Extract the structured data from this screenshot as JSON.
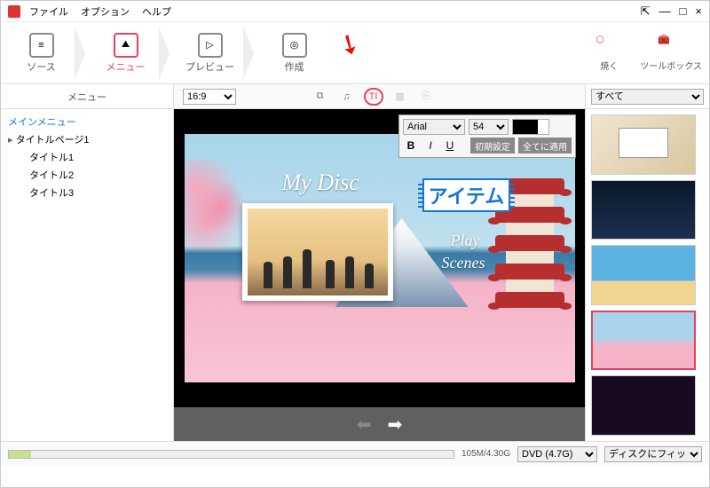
{
  "menubar": {
    "file": "ファイル",
    "option": "オプション",
    "help": "ヘルプ"
  },
  "steps": {
    "source": "ソース",
    "menu": "メニュー",
    "preview": "プレビュー",
    "create": "作成"
  },
  "rtools": {
    "burn": "焼く",
    "toolbox": "ツールボックス"
  },
  "sidebar": {
    "header": "メニュー",
    "mainmenu": "メインメニュー",
    "titlepage": "タイトルページ1",
    "t1": "タイトル1",
    "t2": "タイトル2",
    "t3": "タイトル3"
  },
  "aspect": "16:9",
  "canvas": {
    "title": "My Disc",
    "play": "Play",
    "scenes": "Scenes",
    "item": "アイテム"
  },
  "texttool": {
    "font": "Arial",
    "size": "54",
    "bold": "B",
    "italic": "I",
    "underline": "U",
    "reset": "初期設定",
    "applyall": "全てに適用"
  },
  "rightfilter": "すべて",
  "status": {
    "size": "105M/4.30G",
    "disc": "DVD (4.7G)",
    "fit": "ディスクにフィット"
  }
}
